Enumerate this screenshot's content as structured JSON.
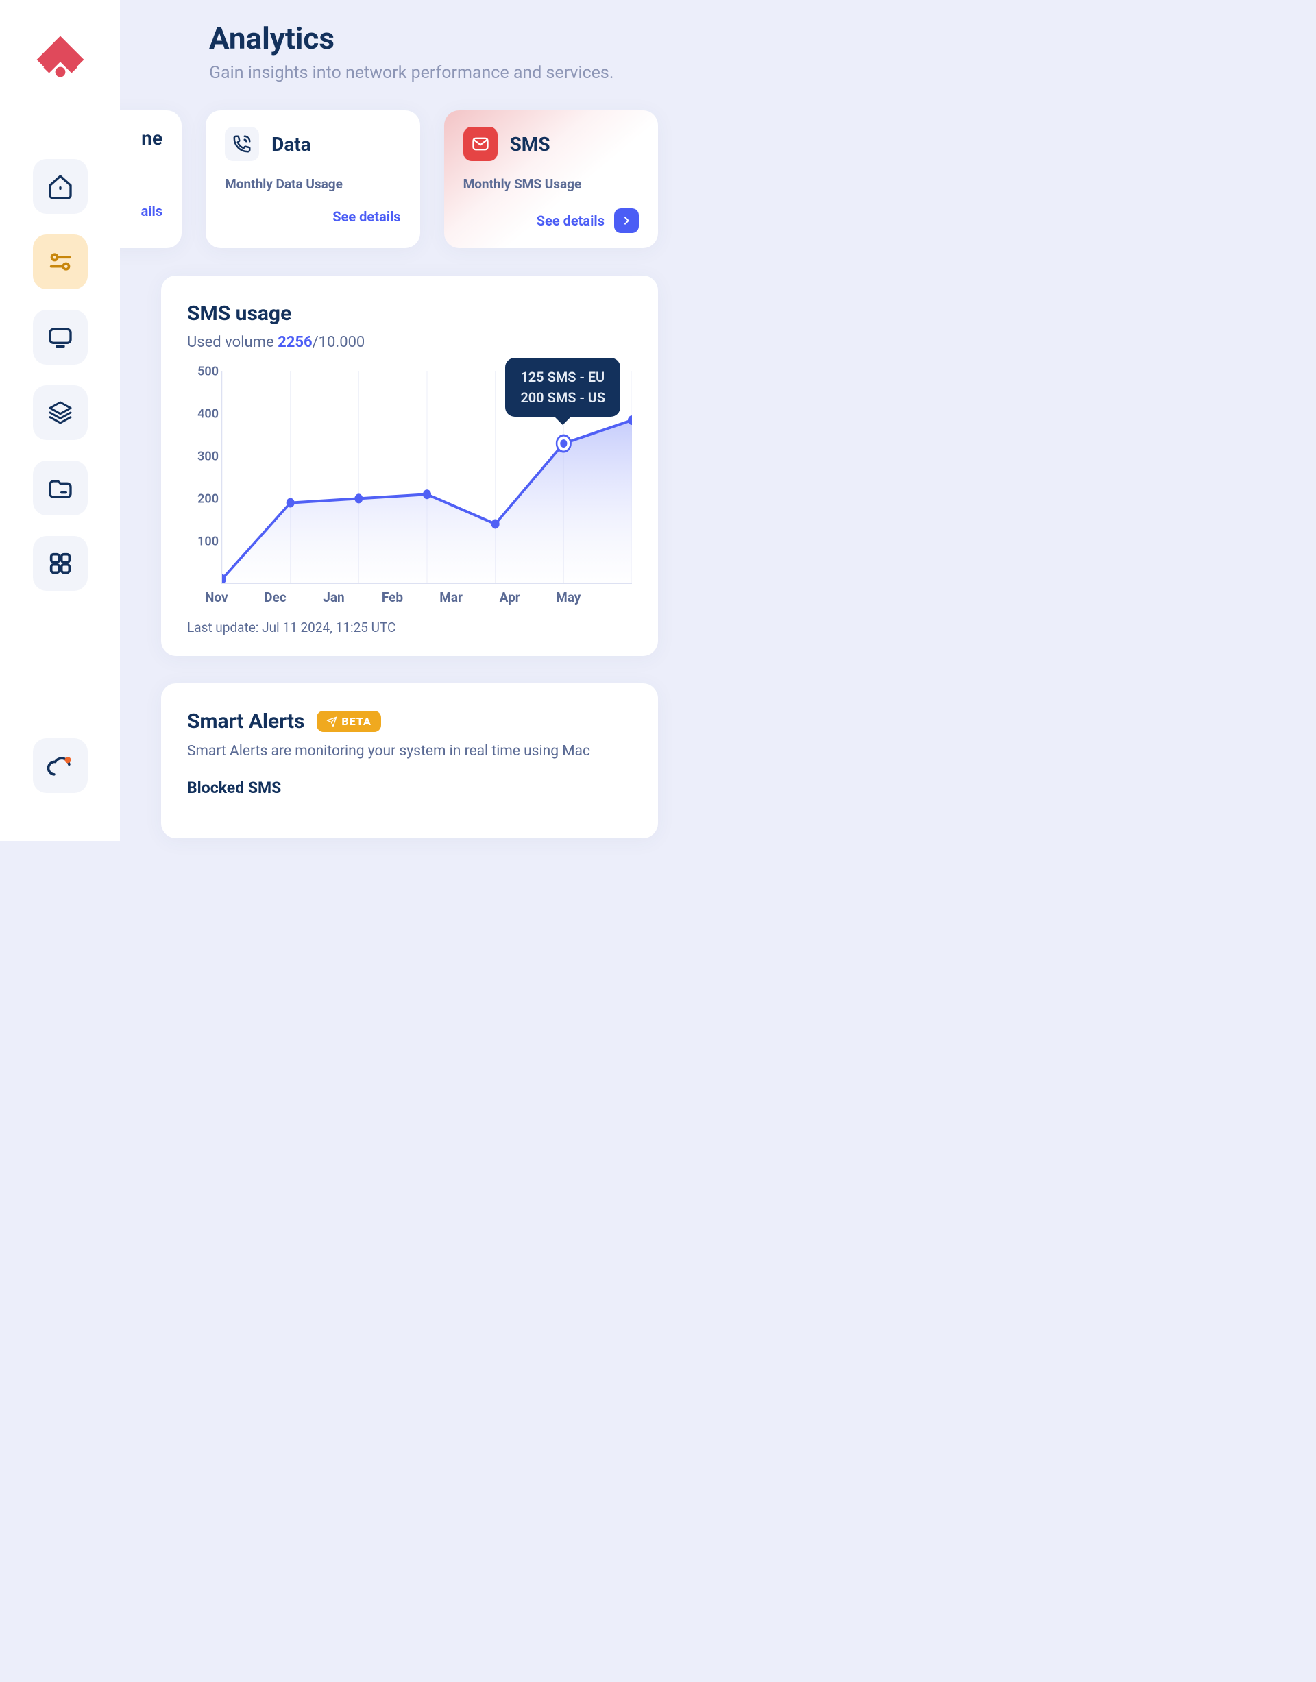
{
  "brand": {
    "name": "logo"
  },
  "sidebar": {
    "items": [
      {
        "name": "nav-home",
        "icon": "home-icon",
        "active": false
      },
      {
        "name": "nav-analytics",
        "icon": "sliders-icon",
        "active": true
      },
      {
        "name": "nav-monitor",
        "icon": "monitor-icon",
        "active": false
      },
      {
        "name": "nav-layers",
        "icon": "layers-icon",
        "active": false
      },
      {
        "name": "nav-folder",
        "icon": "folder-icon",
        "active": false
      },
      {
        "name": "nav-apps",
        "icon": "apps-icon",
        "active": false
      }
    ],
    "bottom": {
      "name": "nav-cloud",
      "icon": "cloud-notification-icon"
    }
  },
  "header": {
    "title": "Analytics",
    "subtitle": "Gain insights into network performance and services."
  },
  "cards": {
    "airtime": {
      "title_fragment": "ne",
      "details_label": "ails"
    },
    "data": {
      "title": "Data",
      "subtitle": "Monthly Data Usage",
      "details_label": "See details"
    },
    "sms": {
      "title": "SMS",
      "subtitle": "Monthly SMS Usage",
      "details_label": "See details"
    }
  },
  "usage_panel": {
    "title": "SMS usage",
    "sub_prefix": "Used volume ",
    "used_value": "2256",
    "sub_suffix": "/10.000",
    "last_update": "Last update: Jul 11 2024, 11:25 UTC",
    "tooltip": {
      "line1": "125 SMS - EU",
      "line2": "200 SMS - US"
    }
  },
  "chart_data": {
    "type": "line",
    "categories": [
      "Nov",
      "Dec",
      "Jan",
      "Feb",
      "Mar",
      "Apr",
      "May"
    ],
    "values": [
      10,
      190,
      200,
      210,
      140,
      330,
      385
    ],
    "ylim": [
      0,
      500
    ],
    "yticks": [
      100,
      200,
      300,
      400,
      500
    ],
    "tooltip_point_index": 5,
    "tooltip_breakdown": [
      {
        "label": "EU",
        "value": 125
      },
      {
        "label": "US",
        "value": 200
      }
    ],
    "ylabel": "",
    "xlabel": "",
    "title": "SMS usage"
  },
  "smart_alerts": {
    "title": "Smart Alerts",
    "badge": "BETA",
    "description": "Smart Alerts are monitoring your system in real time using Mac",
    "blocked_title": "Blocked SMS"
  }
}
